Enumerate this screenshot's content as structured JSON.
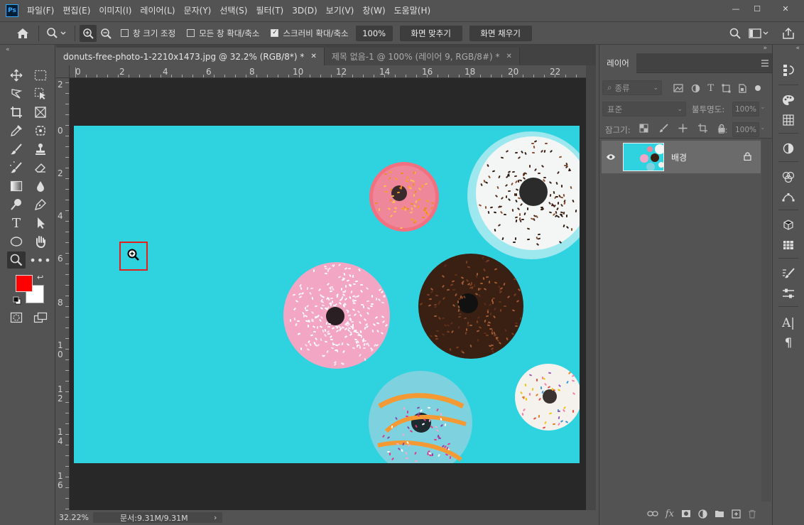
{
  "app": {
    "logo": "Ps"
  },
  "menu": [
    "파일(F)",
    "편집(E)",
    "이미지(I)",
    "레이어(L)",
    "문자(Y)",
    "선택(S)",
    "필터(T)",
    "3D(D)",
    "보기(V)",
    "창(W)",
    "도움말(H)"
  ],
  "window_controls": {
    "minimize": "—",
    "maximize": "☐",
    "close": "✕"
  },
  "options": {
    "resize_windows": "창 크기 조정",
    "zoom_all_windows": "모든 창 확대/축소",
    "scrubby_zoom": "스크러비 확대/축소",
    "zoom_value": "100%",
    "fit_screen": "화면 맞추기",
    "fill_screen": "화면 채우기",
    "resize_windows_checked": false,
    "zoom_all_checked": false,
    "scrubby_checked": true
  },
  "tabs": [
    {
      "label": "donuts-free-photo-1-2210x1473.jpg @ 32.2% (RGB/8*) *",
      "active": true
    },
    {
      "label": "제목 없음-1 @ 100% (레이어 9, RGB/8#) *",
      "active": false
    }
  ],
  "ruler": {
    "h": [
      "0",
      "2",
      "4",
      "6",
      "8",
      "10",
      "12",
      "14",
      "16",
      "18",
      "20",
      "22"
    ],
    "v": [
      "2",
      "0",
      "2",
      "4",
      "6",
      "8",
      "10",
      "12",
      "14",
      "16"
    ]
  },
  "status": {
    "zoom": "32.22%",
    "doc": "문서:9.31M/9.31M",
    "arrow": "›"
  },
  "layers_panel": {
    "tab": "레이어",
    "kind_filter": "종류",
    "blend_mode": "표준",
    "opacity_label": "불투명도:",
    "opacity": "100%",
    "lock_label": "잠그기:",
    "fill_label": "칠:",
    "fill": "100%",
    "layers": [
      {
        "name": "배경",
        "locked": true,
        "visible": true
      }
    ]
  },
  "colors": {
    "foreground": "#ff0000",
    "background": "#ffffff",
    "canvas_bg": "#2fd3e0",
    "highlight_box": "#e2211c"
  }
}
